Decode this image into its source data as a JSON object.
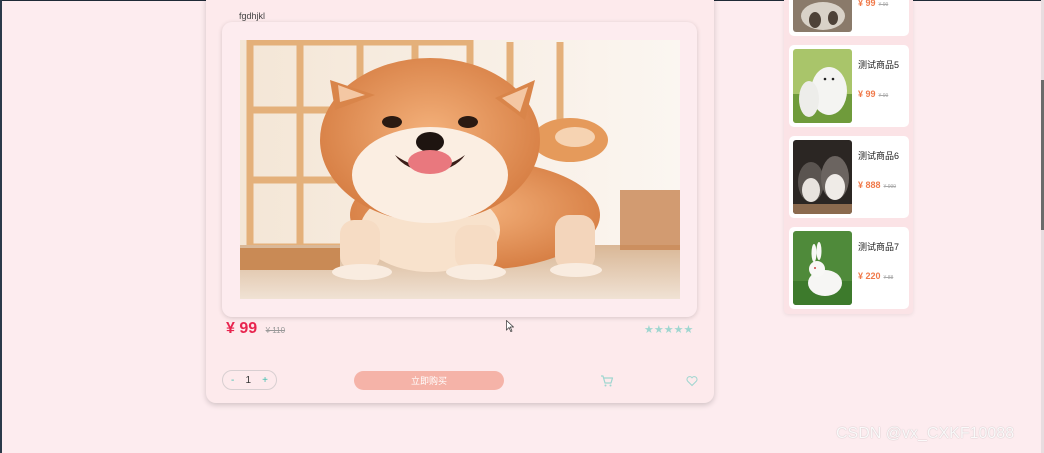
{
  "product": {
    "title": "fgdhjkl",
    "price": "¥ 99",
    "old_price": "¥ 110",
    "rating": 4.5,
    "stars": "★★★★★",
    "quantity": "1",
    "minus": "-",
    "plus": "+",
    "buy_label": "立即购买"
  },
  "list": {
    "items": [
      {
        "name": "",
        "price": "¥ 99",
        "old": "¥ 99"
      },
      {
        "name": "测试商品5",
        "price": "¥ 99",
        "old": "¥ 99"
      },
      {
        "name": "测试商品6",
        "price": "¥ 888",
        "old": "¥ 999"
      },
      {
        "name": "测试商品7",
        "price": "¥ 220",
        "old": "¥ 88"
      }
    ]
  },
  "icons": {
    "cart": "cart-icon",
    "heart": "heart-icon"
  },
  "colors": {
    "background": "#fdecef",
    "price_red": "#e8254f",
    "accent_teal": "#3fbfae",
    "buy_button": "#f5b3a8",
    "list_price": "#f07a4a"
  },
  "watermark": "CSDN @vx_CXKF10088"
}
